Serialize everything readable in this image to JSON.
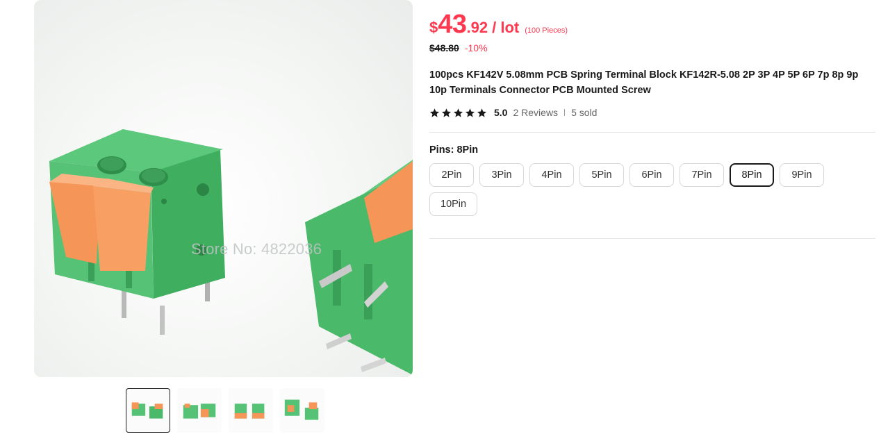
{
  "gallery": {
    "watermark": "Store No: 4822036",
    "thumbnails": [
      "thumb-1",
      "thumb-2",
      "thumb-3",
      "thumb-4"
    ],
    "active_thumbnail": 0
  },
  "price": {
    "currency": "$",
    "integer": "43",
    "decimal": ".92",
    "unit": "/ lot",
    "note": "(100 Pieces)",
    "original": "$48.80",
    "discount": "-10%",
    "color": "#fd384f"
  },
  "product": {
    "title": "100pcs KF142V 5.08mm PCB Spring Terminal Block KF142R-5.08 2P 3P 4P 5P 6P 7p 8p 9p 10p Terminals Connector PCB Mounted Screw",
    "rating": "5.0",
    "stars": 5,
    "reviews": "2 Reviews",
    "sold": "5 sold"
  },
  "sku": {
    "label": "Pins: 8Pin",
    "options": [
      "2Pin",
      "3Pin",
      "4Pin",
      "5Pin",
      "6Pin",
      "7Pin",
      "8Pin",
      "9Pin",
      "10Pin"
    ],
    "selected": "8Pin"
  },
  "colors": {
    "terminal_green": "#4fbe6e",
    "lever_orange": "#f59557",
    "selected_border": "#191919"
  }
}
